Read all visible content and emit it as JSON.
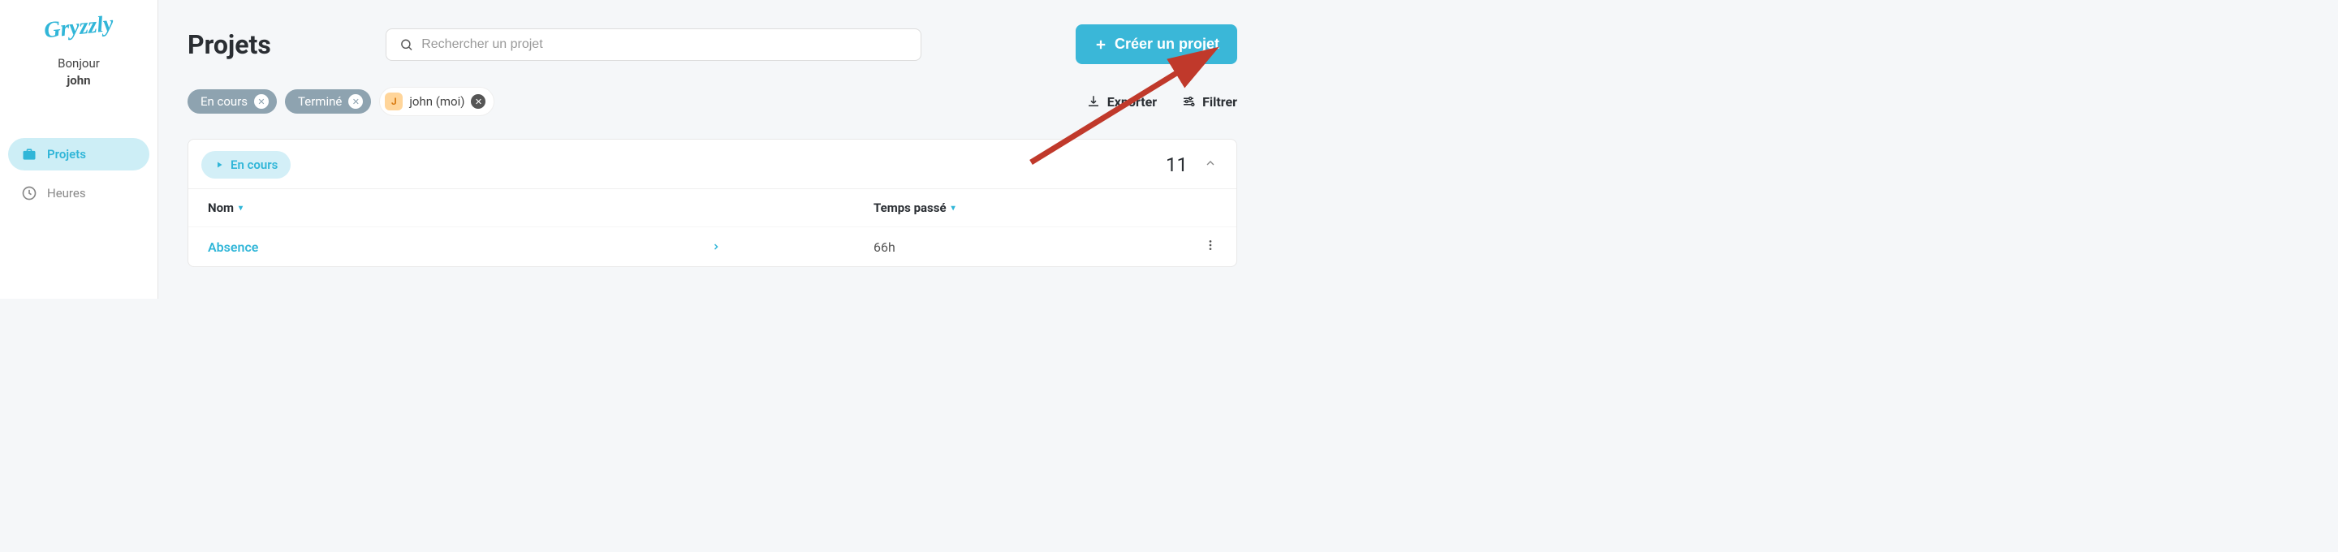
{
  "app": {
    "name": "Gryzzly"
  },
  "greeting": {
    "hello": "Bonjour",
    "user": "john"
  },
  "sidebar": {
    "items": [
      {
        "label": "Projets",
        "icon": "briefcase",
        "active": true
      },
      {
        "label": "Heures",
        "icon": "clock",
        "active": false
      }
    ]
  },
  "header": {
    "title": "Projets",
    "search_placeholder": "Rechercher un projet",
    "create_label": "Créer un projet"
  },
  "filters": {
    "chips": [
      {
        "label": "En cours",
        "style": "gray"
      },
      {
        "label": "Terminé",
        "style": "gray"
      },
      {
        "label": "john (moi)",
        "style": "yellow",
        "avatar_initial": "J"
      }
    ],
    "export_label": "Exporter",
    "filter_label": "Filtrer"
  },
  "section": {
    "status_label": "En cours",
    "count": "11",
    "columns": {
      "name": "Nom",
      "time_spent": "Temps passé"
    },
    "rows": [
      {
        "name": "Absence",
        "time": "66h"
      }
    ]
  }
}
